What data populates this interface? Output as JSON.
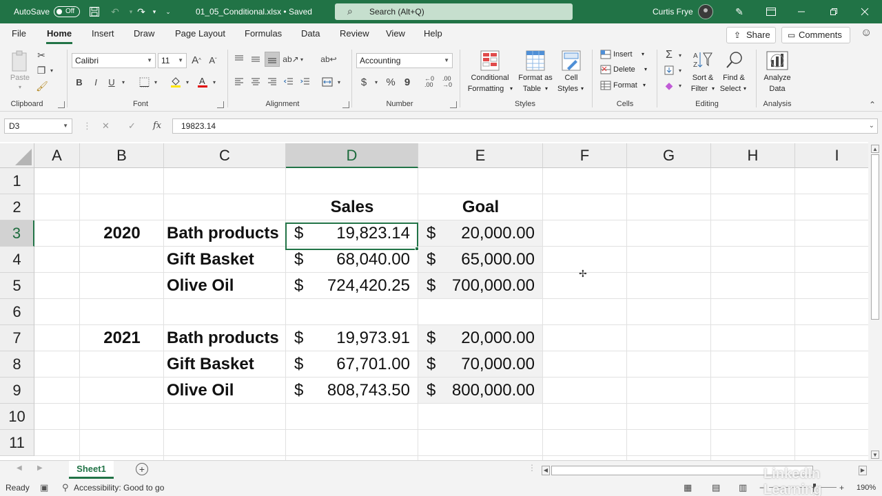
{
  "titlebar": {
    "autosave_label": "AutoSave",
    "autosave_state": "Off",
    "filename": "01_05_Conditional.xlsx • Saved",
    "search_placeholder": "Search (Alt+Q)",
    "user": "Curtis Frye"
  },
  "menu": {
    "tabs": [
      "File",
      "Home",
      "Insert",
      "Draw",
      "Page Layout",
      "Formulas",
      "Data",
      "Review",
      "View",
      "Help"
    ],
    "active": "Home",
    "share_label": "Share",
    "comments_label": "Comments"
  },
  "ribbon": {
    "clipboard": {
      "paste": "Paste",
      "group": "Clipboard"
    },
    "font": {
      "name": "Calibri",
      "size": "11",
      "group": "Font",
      "bold": "B",
      "italic": "I",
      "underline": "U"
    },
    "alignment": {
      "group": "Alignment"
    },
    "number": {
      "format": "Accounting",
      "group": "Number"
    },
    "styles": {
      "conditional_1": "Conditional",
      "conditional_2": "Formatting",
      "format_table_1": "Format as",
      "format_table_2": "Table",
      "cell_styles_1": "Cell",
      "cell_styles_2": "Styles",
      "group": "Styles"
    },
    "cells": {
      "insert": "Insert",
      "delete": "Delete",
      "format": "Format",
      "group": "Cells"
    },
    "editing": {
      "sort_1": "Sort &",
      "sort_2": "Filter",
      "find_1": "Find &",
      "find_2": "Select",
      "group": "Editing"
    },
    "analysis": {
      "analyze_1": "Analyze",
      "analyze_2": "Data",
      "group": "Analysis"
    }
  },
  "formula_bar": {
    "name_box": "D3",
    "formula": "19823.14"
  },
  "grid": {
    "columns": [
      "A",
      "B",
      "C",
      "D",
      "E",
      "F",
      "G",
      "H",
      "I"
    ],
    "selected_column": "D",
    "rows": [
      "1",
      "2",
      "3",
      "4",
      "5",
      "6",
      "7",
      "8",
      "9",
      "10",
      "11"
    ],
    "selected_row": "3",
    "headers": {
      "sales": "Sales",
      "goal": "Goal"
    },
    "years": [
      "2020",
      "2021"
    ],
    "currency": "$",
    "data": [
      {
        "product": "Bath products",
        "sales": "19,823.14",
        "goal": "20,000.00"
      },
      {
        "product": "Gift Basket",
        "sales": "68,040.00",
        "goal": "65,000.00"
      },
      {
        "product": "Olive Oil",
        "sales": "724,420.25",
        "goal": "700,000.00"
      },
      {
        "product": "Bath products",
        "sales": "19,973.91",
        "goal": "20,000.00"
      },
      {
        "product": "Gift Basket",
        "sales": "67,701.00",
        "goal": "70,000.00"
      },
      {
        "product": "Olive Oil",
        "sales": "808,743.50",
        "goal": "800,000.00"
      }
    ]
  },
  "sheets": {
    "active": "Sheet1"
  },
  "status": {
    "ready": "Ready",
    "accessibility": "Accessibility: Good to go",
    "zoom": "190%"
  },
  "watermark": "LinkedIn Learning",
  "colors": {
    "accent": "#217346",
    "title_bar": "#217346"
  }
}
